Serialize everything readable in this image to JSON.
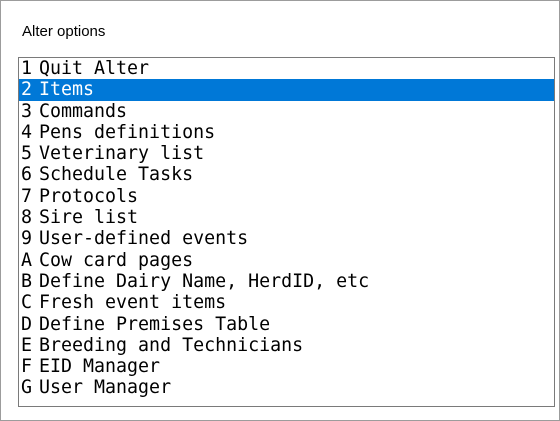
{
  "window": {
    "title": "Alter options"
  },
  "options": [
    {
      "key": "1",
      "label": "Quit Alter",
      "selected": false
    },
    {
      "key": "2",
      "label": "Items",
      "selected": true
    },
    {
      "key": "3",
      "label": "Commands",
      "selected": false
    },
    {
      "key": "4",
      "label": "Pens definitions",
      "selected": false
    },
    {
      "key": "5",
      "label": "Veterinary list",
      "selected": false
    },
    {
      "key": "6",
      "label": "Schedule Tasks",
      "selected": false
    },
    {
      "key": "7",
      "label": "Protocols",
      "selected": false
    },
    {
      "key": "8",
      "label": "Sire list",
      "selected": false
    },
    {
      "key": "9",
      "label": "User-defined events",
      "selected": false
    },
    {
      "key": "A",
      "label": "Cow card pages",
      "selected": false
    },
    {
      "key": "B",
      "label": "Define Dairy Name, HerdID, etc",
      "selected": false
    },
    {
      "key": "C",
      "label": "Fresh event items",
      "selected": false
    },
    {
      "key": "D",
      "label": "Define Premises Table",
      "selected": false
    },
    {
      "key": "E",
      "label": "Breeding and Technicians",
      "selected": false
    },
    {
      "key": "F",
      "label": "EID Manager",
      "selected": false
    },
    {
      "key": "G",
      "label": "User Manager",
      "selected": false
    }
  ],
  "colors": {
    "selection_background": "#0078d7",
    "selection_text": "#ffffff"
  }
}
